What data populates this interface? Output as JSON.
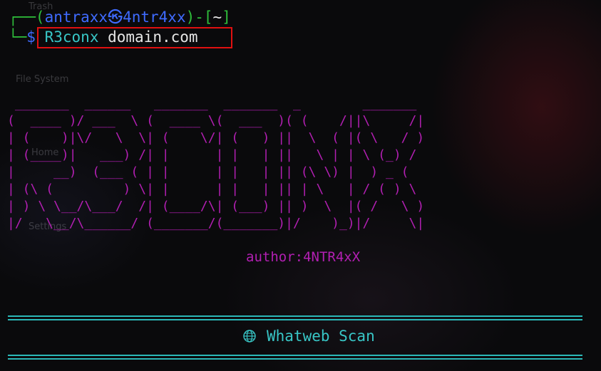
{
  "desktop": {
    "labels": [
      "Trash",
      "File System",
      "Home",
      "Settings"
    ]
  },
  "prompt": {
    "open_bracket": "┌──(",
    "user_host": "antraxx㉿4ntr4xx",
    "close_bracket": ")-[",
    "cwd": "~",
    "end_bracket": "]",
    "line2_prefix": "└─",
    "dollar": "$",
    "command": "R3conx",
    "argument": "domain.com"
  },
  "banner": {
    "ascii_lines": [
      " _______  ______   _______  _______  _        _______          ",
      "(  ____ )/ ___  \\ (  ____ \\(  ___  )( (    /||\\     /|",
      "| (    )|\\/   \\  \\| (    \\/| (   ) ||  \\  ( |( \\   / )",
      "| (____)|   ___) /| |      | |   | ||   \\ | | \\ (_) / ",
      "|     __)  (___ ( | |      | |   | || (\\ \\) |  ) _ (  ",
      "| (\\ (         ) \\| |      | |   | || | \\   | / ( ) \\ ",
      "| ) \\ \\__/\\___/  /| (____/\\| (___) || )  \\  |( /   \\ )",
      "|/   \\__/\\______/ (_______/(_______)|/    )_)|/     \\|"
    ],
    "author": "author:4NTR4xX"
  },
  "section": {
    "title": "Whatweb Scan",
    "icon": "globe-icon"
  },
  "colors": {
    "prompt_green": "#2fbf3b",
    "prompt_blue": "#3f6bff",
    "banner_magenta": "#b21fb2",
    "accent_cyan": "#38c6c6",
    "highlight_red": "#e01010"
  }
}
